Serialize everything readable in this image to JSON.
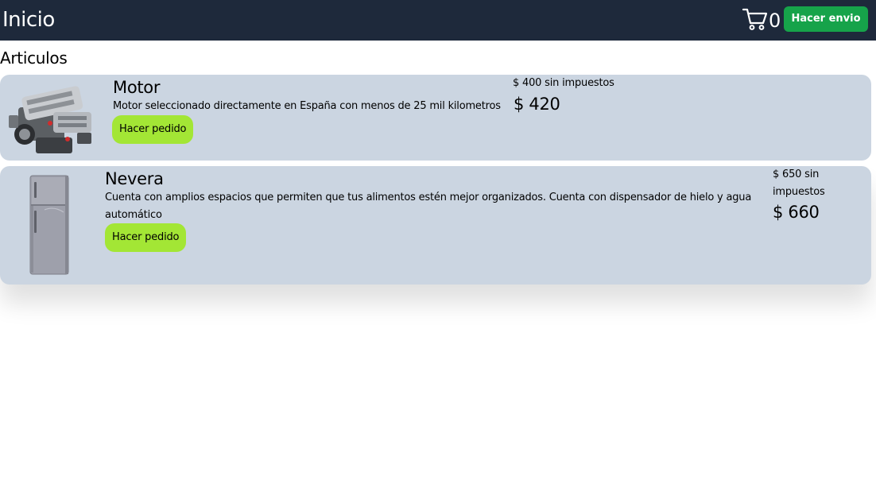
{
  "header": {
    "title": "Inicio",
    "cart_count": "0",
    "send_button": "Hacer envio"
  },
  "section": {
    "title": "Articulos"
  },
  "products": [
    {
      "name": "Motor",
      "description": "Motor seleccionado directamente en España con menos de 25 mil kilometros",
      "price_before_tax": "$ 400 sin impuestos",
      "price": "$ 420",
      "order_button": "Hacer pedido",
      "image_icon": "engine-image"
    },
    {
      "name": "Nevera",
      "description": "Cuenta con amplios espacios que permiten que tus alimentos estén mejor organizados. Cuenta con dispensador de hielo y agua automático",
      "price_before_tax": "$ 650 sin impuestos",
      "price": "$ 660",
      "order_button": "Hacer pedido",
      "image_icon": "fridge-image"
    }
  ],
  "colors": {
    "navbar": "#1e293b",
    "send_button": "#16a34a",
    "card": "#cbd5e1",
    "order_button": "#a3e635"
  }
}
